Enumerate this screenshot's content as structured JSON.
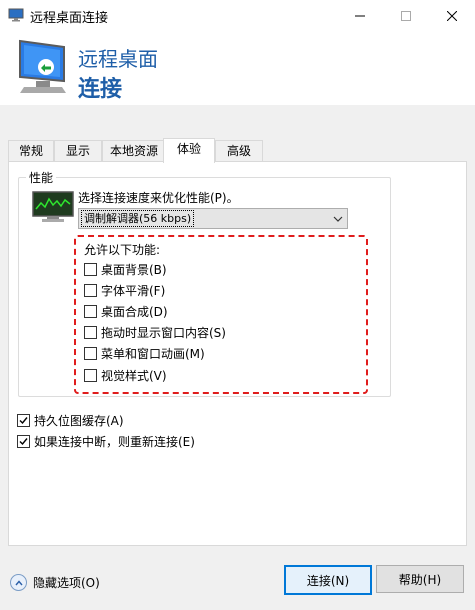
{
  "window": {
    "title": "远程桌面连接"
  },
  "header": {
    "line1": "远程桌面",
    "line2": "连接"
  },
  "tabs": [
    {
      "label": "常规"
    },
    {
      "label": "显示"
    },
    {
      "label": "本地资源"
    },
    {
      "label": "体验",
      "active": true
    },
    {
      "label": "高级"
    }
  ],
  "performance": {
    "group_label": "性能",
    "speed_label": "选择连接速度来优化性能(P)。",
    "speed_value": "调制解调器(56 kbps)",
    "allow_label": "允许以下功能:",
    "features": [
      {
        "label": "桌面背景(B)",
        "checked": false
      },
      {
        "label": "字体平滑(F)",
        "checked": false
      },
      {
        "label": "桌面合成(D)",
        "checked": false
      },
      {
        "label": "拖动时显示窗口内容(S)",
        "checked": false
      },
      {
        "label": "菜单和窗口动画(M)",
        "checked": false
      },
      {
        "label": "视觉样式(V)",
        "checked": false
      }
    ]
  },
  "options": [
    {
      "label": "持久位图缓存(A)",
      "checked": true
    },
    {
      "label": "如果连接中断，则重新连接(E)",
      "checked": true
    }
  ],
  "footer": {
    "hide_options_label": "隐藏选项(O)",
    "connect_label": "连接(N)",
    "help_label": "帮助(H)"
  },
  "colors": {
    "accent": "#1e5ea8",
    "highlight": "#e01c1c",
    "focus": "#0078d7"
  }
}
